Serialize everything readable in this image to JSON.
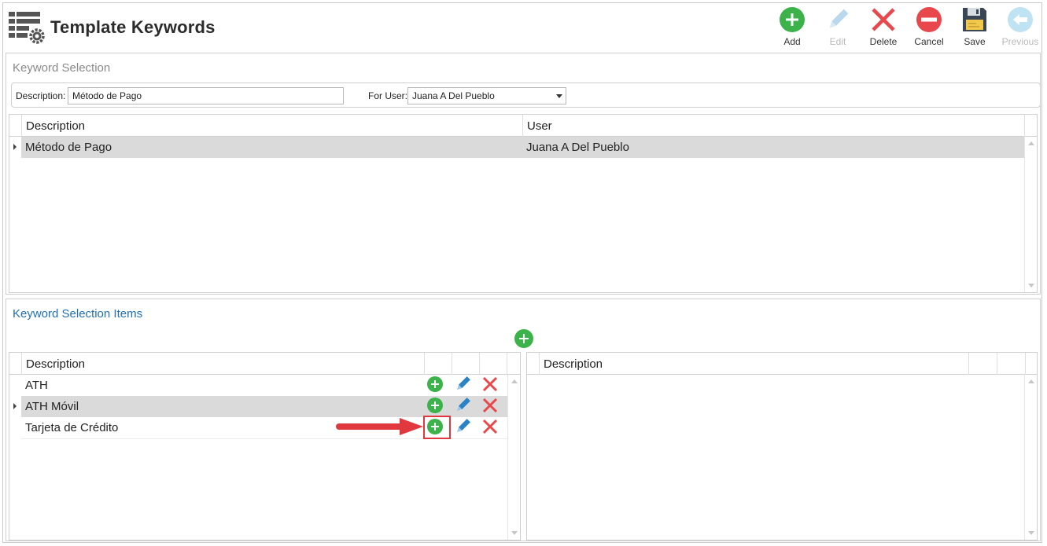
{
  "header": {
    "title": "Template Keywords",
    "toolbar": [
      {
        "label": "Add",
        "icon": "add-icon",
        "enabled": true
      },
      {
        "label": "Edit",
        "icon": "pencil-icon",
        "enabled": false
      },
      {
        "label": "Delete",
        "icon": "x-icon",
        "enabled": true
      },
      {
        "label": "Cancel",
        "icon": "minus-circle-icon",
        "enabled": true
      },
      {
        "label": "Save",
        "icon": "floppy-disk-icon",
        "enabled": true
      },
      {
        "label": "Previous",
        "icon": "arrow-left-icon",
        "enabled": false
      }
    ]
  },
  "keyword_selection": {
    "title": "Keyword Selection",
    "filters": {
      "description_label": "Description:",
      "description_value": "Método de Pago",
      "user_label": "For User:",
      "user_value": "Juana A Del Pueblo"
    },
    "grid": {
      "columns": [
        "Description",
        "User"
      ],
      "rows": [
        {
          "description": "Método de Pago",
          "user": "Juana A Del Pueblo",
          "selected": true
        }
      ]
    }
  },
  "keyword_items": {
    "title": "Keyword Selection Items",
    "left_grid": {
      "columns": [
        "Description"
      ],
      "rows": [
        {
          "description": "ATH",
          "selected": false
        },
        {
          "description": "ATH Móvil",
          "selected": true
        },
        {
          "description": "Tarjeta de Crédito",
          "selected": false
        }
      ]
    },
    "right_grid": {
      "columns": [
        "Description"
      ],
      "rows": []
    }
  },
  "colors": {
    "add_green": "#3bb34a",
    "delete_red": "#e8474c",
    "edit_blue": "#2a83c6",
    "link_blue": "#1f6fb5",
    "selected_row": "#dadada",
    "annotation_red": "#e0383e"
  }
}
